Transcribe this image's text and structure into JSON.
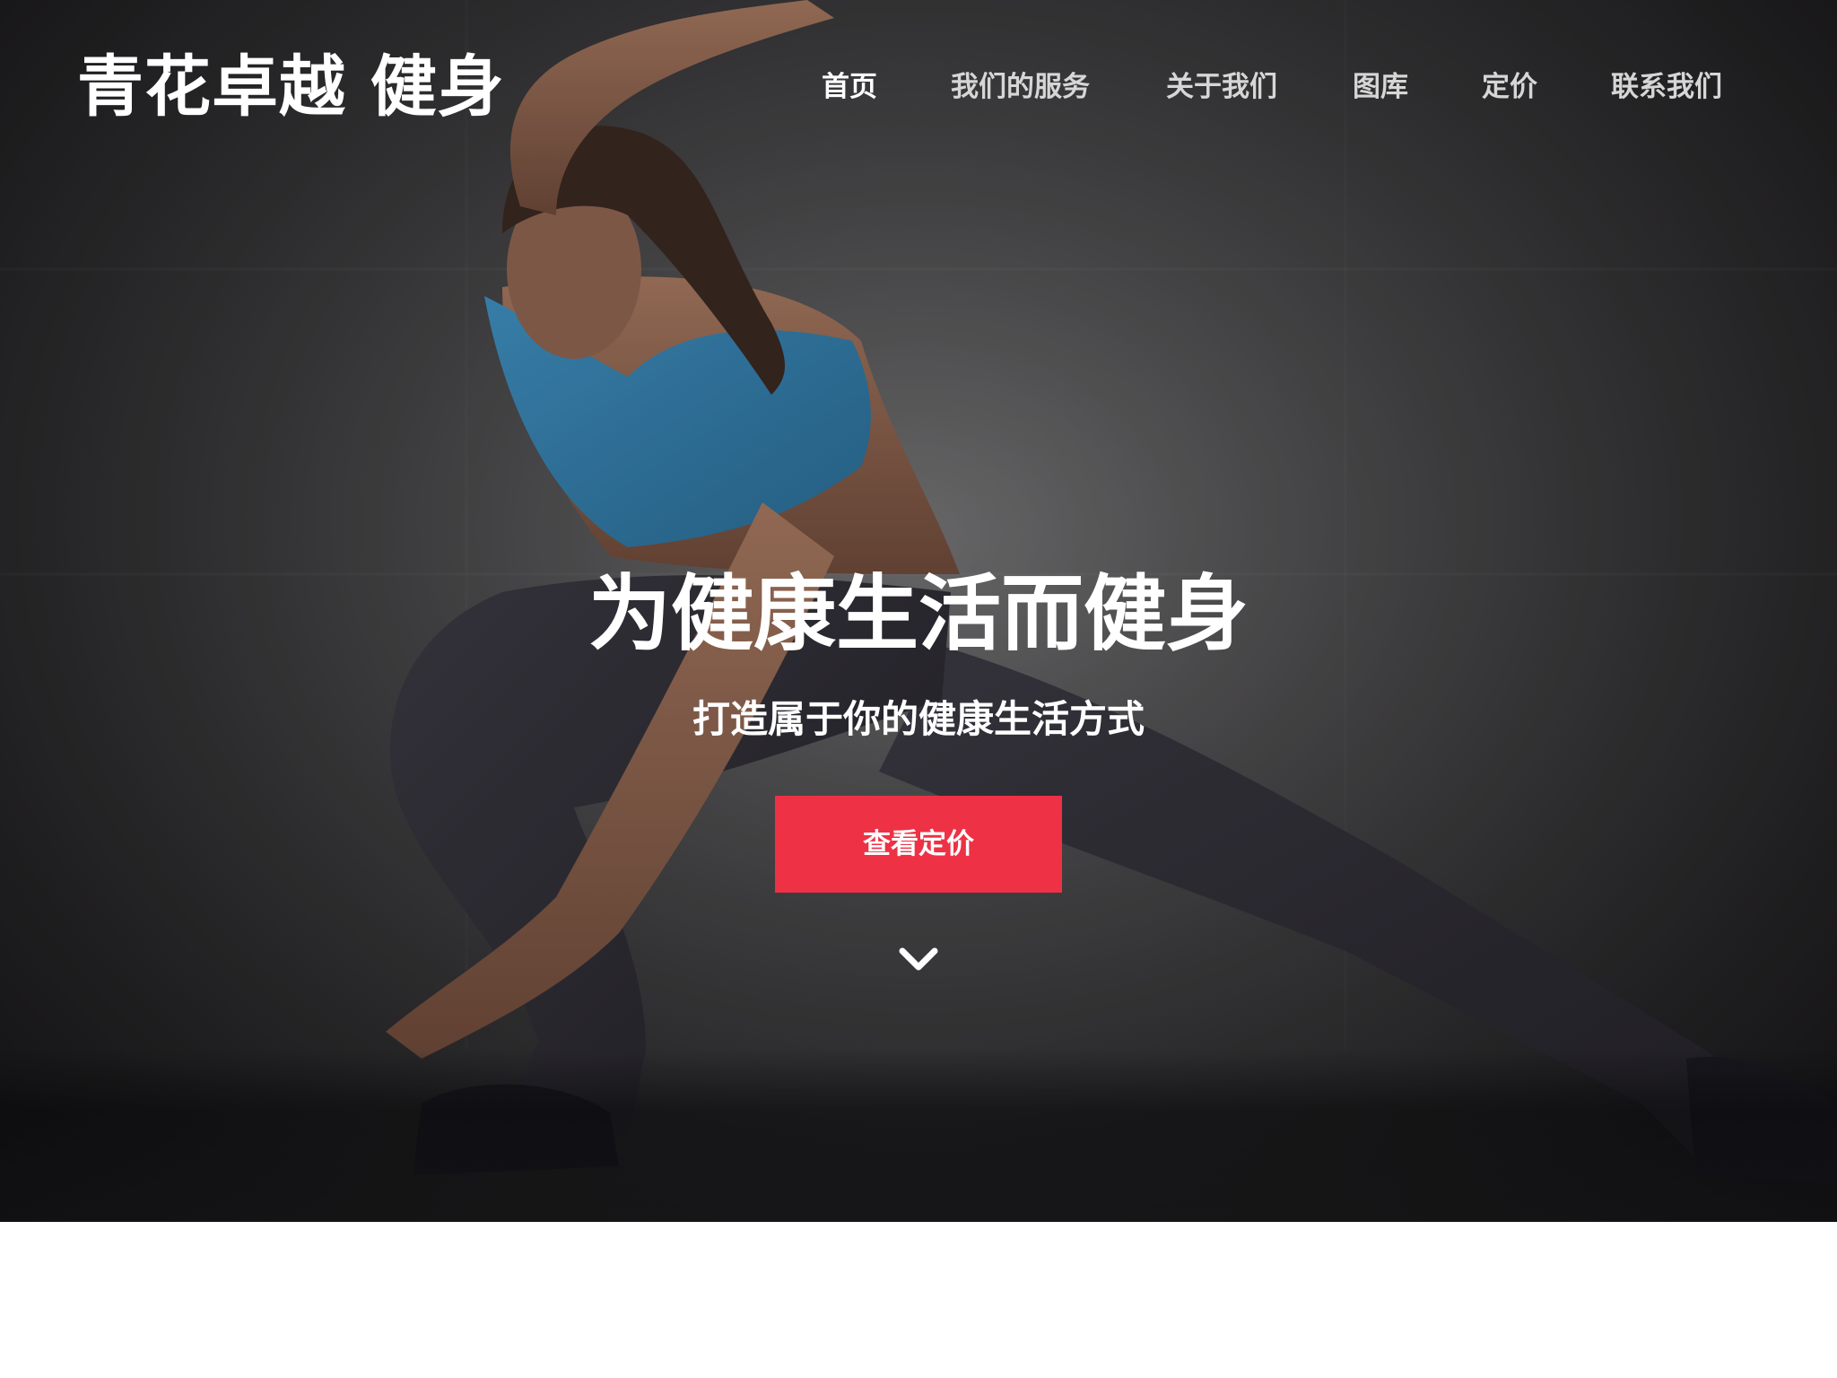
{
  "brand": {
    "logo": "青花卓越 健身"
  },
  "nav": {
    "items": [
      {
        "label": "首页",
        "active": true
      },
      {
        "label": "我们的服务",
        "active": false
      },
      {
        "label": "关于我们",
        "active": false
      },
      {
        "label": "图库",
        "active": false
      },
      {
        "label": "定价",
        "active": false
      },
      {
        "label": "联系我们",
        "active": false
      }
    ]
  },
  "hero": {
    "headline": "为健康生活而健身",
    "subheadline": "打造属于你的健康生活方式",
    "cta_label": "查看定价",
    "scroll_icon": "chevron-down-icon"
  },
  "colors": {
    "accent": "#ee3145",
    "nav_text": "#d6d6d6",
    "text": "#ffffff"
  }
}
